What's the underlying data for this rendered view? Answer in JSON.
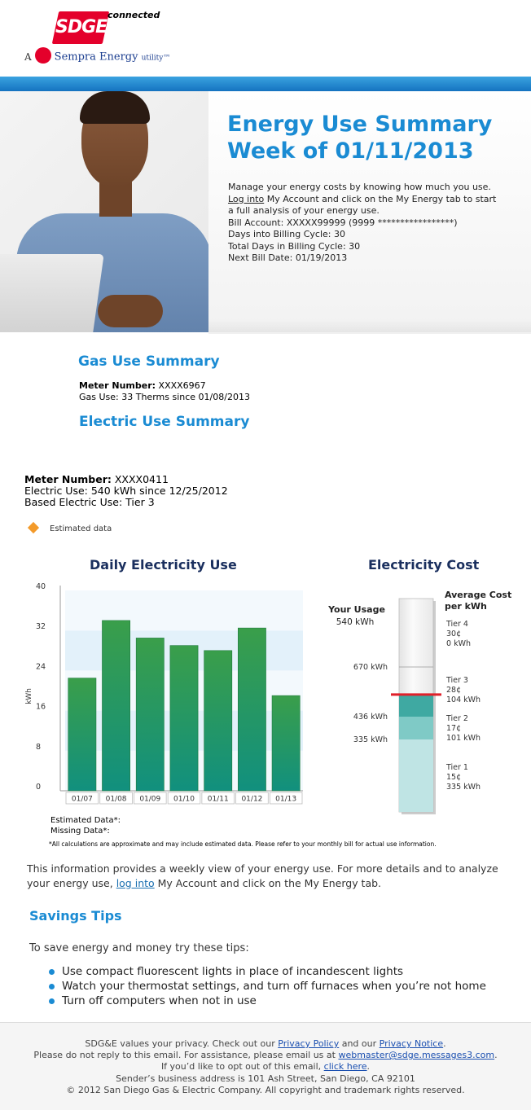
{
  "header": {
    "logo_text": "SDGE",
    "logo_suffix": "connected",
    "sempra_prefix": "A",
    "sempra_name": "Sempra Energy",
    "sempra_suffix": "utility",
    "sempra_tm": "™"
  },
  "hero": {
    "title_line1": "Energy Use Summary",
    "title_line2": "Week of 01/11/2013",
    "intro": "Manage your energy costs by knowing how much you use.",
    "login_link": "Log into",
    "login_rest": " My Account and click on the My Energy tab to start",
    "analysis": "a full analysis of your energy use.",
    "bill_account": "Bill Account: XXXXX99999 (9999 *****************)",
    "days_into": "Days into Billing Cycle: 30",
    "total_days": "Total Days in Billing Cycle: 30",
    "next_bill": "Next Bill Date: 01/19/2013"
  },
  "gas": {
    "title": "Gas Use Summary",
    "meter_label": "Meter Number:",
    "meter_value": " XXXX6967",
    "use": "Gas Use: 33 Therms since 01/08/2013"
  },
  "electric": {
    "title": "Electric Use Summary",
    "meter_label": "Meter Number:",
    "meter_value": " XXXX0411",
    "use": "Electric Use: 540 kWh since 12/25/2012",
    "based": "Based Electric Use: Tier 3"
  },
  "estimated_label": "Estimated data",
  "daily_chart_title": "Daily Electricity Use",
  "cost_chart_title": "Electricity Cost",
  "legend": {
    "estimated": "Estimated Data*:",
    "missing": "Missing Data*:"
  },
  "footnote": "*All calculations are approximate and may include estimated data. Please refer to your monthly bill for actual use information.",
  "info": {
    "text_before": "This information provides a weekly view of your energy use. For more details and to analyze your energy use, ",
    "link": "log into",
    "text_after": " My Account and click on the My Energy tab."
  },
  "tips": {
    "title": "Savings Tips",
    "intro": "To save energy and money try these tips:",
    "items": [
      "Use compact fluorescent lights in place of incandescent lights",
      "Watch your thermostat settings, and turn off furnaces when you’re not home",
      "Turn off computers when not in use"
    ]
  },
  "footer": {
    "l1_before": "SDG&E values your privacy. Check out our ",
    "privacy_policy": "Privacy Policy",
    "l1_mid": " and our ",
    "privacy_notice": "Privacy Notice",
    "l1_end": ".",
    "l2_before": "Please do not reply to this email. For assistance, please email us at ",
    "email": "webmaster@sdge.messages3.com",
    "l2_end": ".",
    "l3_before": "If you’d like to opt out of this email, ",
    "click_here": "click here",
    "l3_end": ".",
    "l4": "Sender’s business address is 101 Ash Street, San Diego, CA 92101",
    "l5": "© 2012 San Diego Gas & Electric Company. All copyright and trademark rights reserved."
  },
  "colors": {
    "accent_blue": "#1a8bd3",
    "bar_green": "#2f9a4e",
    "meter_red": "#e0202a",
    "diamond_orange": "#f39a2a"
  },
  "chart_data": [
    {
      "type": "bar",
      "title": "Daily Electricity Use",
      "ylabel": "kWh",
      "categories": [
        "01/07",
        "01/08",
        "01/09",
        "01/10",
        "01/11",
        "01/12",
        "01/13"
      ],
      "values": [
        22.5,
        34,
        30.5,
        29,
        28,
        32.5,
        19
      ],
      "ylim": [
        0,
        40
      ],
      "yticks": [
        0,
        8,
        16,
        24,
        32,
        40
      ]
    },
    {
      "type": "bar",
      "title": "Electricity Cost",
      "usage_label": "Your Usage",
      "usage_value": "540 kWh",
      "usage": 540,
      "header_label": "Average Cost per kWh",
      "thresholds": [
        {
          "label": "670 kWh",
          "value": 670
        },
        {
          "label": "436 kWh",
          "value": 436
        },
        {
          "label": "335 kWh",
          "value": 335
        }
      ],
      "tiers": [
        {
          "name": "Tier 4",
          "cost": "30¢",
          "kwh": "0 kWh"
        },
        {
          "name": "Tier 3",
          "cost": "28¢",
          "kwh": "104 kWh"
        },
        {
          "name": "Tier 2",
          "cost": "17¢",
          "kwh": "101 kWh"
        },
        {
          "name": "Tier 1",
          "cost": "15¢",
          "kwh": "335 kWh"
        }
      ]
    }
  ]
}
